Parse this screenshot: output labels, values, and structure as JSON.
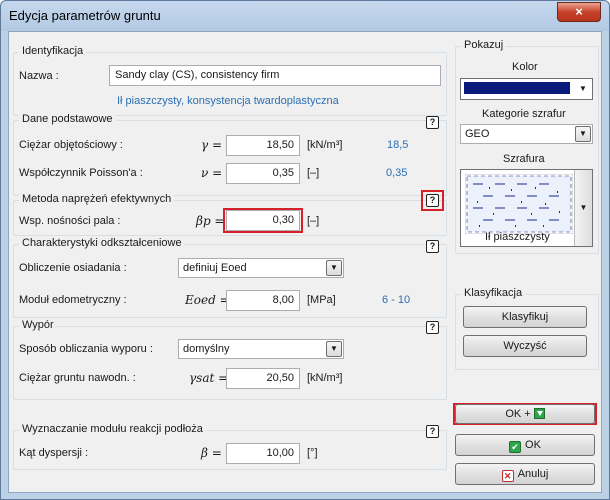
{
  "window": {
    "title": "Edycja parametrów gruntu",
    "close": "×"
  },
  "colors": {
    "accent_blue": "#2a6fb5",
    "highlight_red": "#d6202a",
    "kolor_swatch": "#0a1a7a"
  },
  "identyfikacja": {
    "legend": "Identyfikacja",
    "nazwa_label": "Nazwa :",
    "nazwa_value": "Sandy clay (CS), consistency firm",
    "description": "Ił piaszczysty, konsystencja twardoplastyczna"
  },
  "dane": {
    "legend": "Dane podstawowe",
    "ciezar_label": "Ciężar objętościowy :",
    "ciezar_sym": "γ =",
    "ciezar_value": "18,50",
    "ciezar_unit": "[kN/m³]",
    "ciezar_hint": "18,5",
    "poisson_label": "Współczynnik Poisson'a :",
    "poisson_sym": "ν =",
    "poisson_value": "0,35",
    "poisson_unit": "[–]",
    "poisson_hint": "0,35"
  },
  "metoda": {
    "legend": "Metoda naprężeń efektywnych",
    "label": "Wsp. nośności pala :",
    "sym": "βp =",
    "value": "0,30",
    "unit": "[–]"
  },
  "charakterystyki": {
    "legend": "Charakterystyki odkształceniowe",
    "obliczenie_label": "Obliczenie osiadania :",
    "obliczenie_value": "definiuj Eoed",
    "modul_label": "Moduł edometryczny :",
    "modul_sym": "Eoed =",
    "modul_value": "8,00",
    "modul_unit": "[MPa]",
    "modul_hint": "6 - 10"
  },
  "wypor": {
    "legend": "Wypór",
    "sposob_label": "Sposób obliczania wyporu :",
    "sposob_value": "domyślny",
    "ciezar_label": "Ciężar gruntu nawodn. :",
    "ciezar_sym": "γsat =",
    "ciezar_value": "20,50",
    "ciezar_unit": "[kN/m³]"
  },
  "wyznaczanie": {
    "legend": "Wyznaczanie modułu reakcji podłoża",
    "kat_label": "Kąt dyspersji :",
    "kat_sym": "β =",
    "kat_value": "10,00",
    "kat_unit": "[°]"
  },
  "pokazuj": {
    "legend": "Pokazuj",
    "kolor_label": "Kolor",
    "kategorie_label": "Kategorie szrafur",
    "kategorie_value": "GEO",
    "szrafura_label": "Szrafura",
    "szrafura_name": "Ił piaszczysty"
  },
  "klasyfikacja": {
    "legend": "Klasyfikacja",
    "klasyfikuj": "Klasyfikuj",
    "wyczysc": "Wyczyść"
  },
  "buttons": {
    "ok_plus": "OK +",
    "ok": "OK",
    "anuluj": "Anuluj"
  },
  "help_glyph": "?"
}
